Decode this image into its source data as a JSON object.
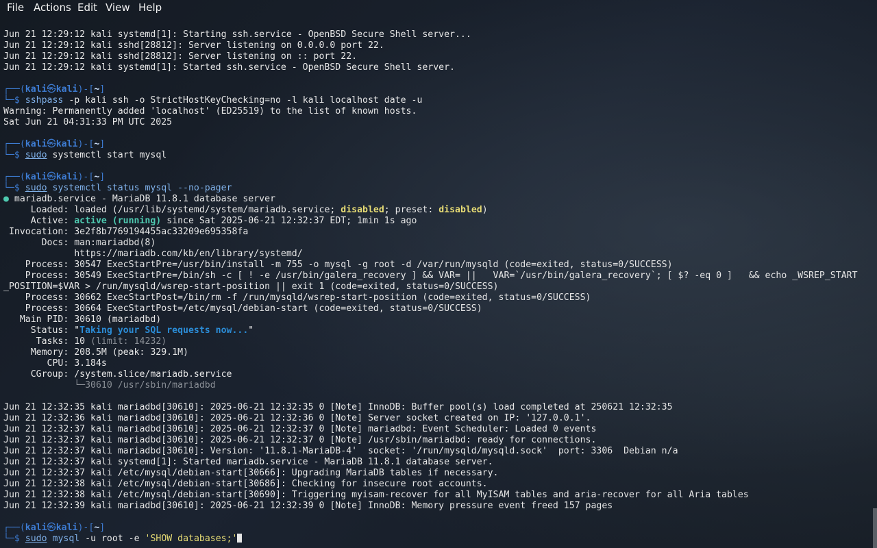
{
  "menubar": {
    "file": "File",
    "actions": "Actions",
    "edit": "Edit",
    "view": "View",
    "help": "Help"
  },
  "prompt": {
    "head": "┌──(",
    "user": "kali",
    "at": "㉿",
    "host": "kali",
    "dir_open": ")-[",
    "dir": "~",
    "dir_close": "]",
    "tail": "└─$"
  },
  "lines": {
    "l01": "Jun 21 12:29:12 kali systemd[1]: Starting ssh.service - OpenBSD Secure Shell server...",
    "l02": "Jun 21 12:29:12 kali sshd[28812]: Server listening on 0.0.0.0 port 22.",
    "l03": "Jun 21 12:29:12 kali sshd[28812]: Server listening on :: port 22.",
    "l04": "Jun 21 12:29:12 kali systemd[1]: Started ssh.service - OpenBSD Secure Shell server.",
    "cmd1_a": "sshpass",
    "cmd1_b": "-p kali ssh -o StrictHostKeyChecking=no -l kali localhost date -u",
    "l05": "Warning: Permanently added 'localhost' (ED25519) to the list of known hosts.",
    "l06": "Sat Jun 21 04:31:33 PM UTC 2025",
    "cmd2_sudo": "sudo",
    "cmd2_rest": "systemctl start mysql",
    "cmd3_sudo": "sudo",
    "cmd3_rest": "systemctl status mysql --no-pager",
    "svc_dot": "●",
    "svc_title": "mariadb.service - MariaDB 11.8.1 database server",
    "loaded_label": "     Loaded: ",
    "loaded_pre": "loaded (/usr/lib/systemd/system/mariadb.service; ",
    "loaded_disabled": "disabled",
    "loaded_mid": "; preset: ",
    "loaded_preset": "disabled",
    "loaded_end": ")",
    "active_label": "     Active: ",
    "active_state": "active (running)",
    "active_rest": " since Sat 2025-06-21 12:32:37 EDT; 1min 1s ago",
    "invocation": " Invocation: 3e2f8b7769194455ac33209e695358fa",
    "docs1": "       Docs: man:mariadbd(8)",
    "docs2": "             https://mariadb.com/kb/en/library/systemd/",
    "proc1": "    Process: 30547 ExecStartPre=/usr/bin/install -m 755 -o mysql -g root -d /var/run/mysqld (code=exited, status=0/SUCCESS)",
    "proc2a": "    Process: 30549 ExecStartPre=/bin/sh -c [ ! -e /usr/bin/galera_recovery ] && VAR= ||   VAR=`/usr/bin/galera_recovery`; [ $? -eq 0 ]   && echo _WSREP_START",
    "proc2b": "_POSITION=$VAR > /run/mysqld/wsrep-start-position || exit 1 (code=exited, status=0/SUCCESS)",
    "proc3": "    Process: 30662 ExecStartPost=/bin/rm -f /run/mysqld/wsrep-start-position (code=exited, status=0/SUCCESS)",
    "proc4": "    Process: 30664 ExecStartPost=/etc/mysql/debian-start (code=exited, status=0/SUCCESS)",
    "mainpid": "   Main PID: 30610 (mariadbd)",
    "status_label": "     Status: \"",
    "status_val": "Taking your SQL requests now...",
    "status_end": "\"",
    "tasks_label": "      Tasks: 10 ",
    "tasks_limit": "(limit: 14232)",
    "memory": "     Memory: 208.5M (peak: 329.1M)",
    "cpu": "        CPU: 3.184s",
    "cgroup": "     CGroup: /system.slice/mariadb.service",
    "cgroup_child": "             └─30610 /usr/sbin/mariadbd",
    "j01": "Jun 21 12:32:35 kali mariadbd[30610]: 2025-06-21 12:32:35 0 [Note] InnoDB: Buffer pool(s) load completed at 250621 12:32:35",
    "j02": "Jun 21 12:32:36 kali mariadbd[30610]: 2025-06-21 12:32:36 0 [Note] Server socket created on IP: '127.0.0.1'.",
    "j03": "Jun 21 12:32:37 kali mariadbd[30610]: 2025-06-21 12:32:37 0 [Note] mariadbd: Event Scheduler: Loaded 0 events",
    "j04": "Jun 21 12:32:37 kali mariadbd[30610]: 2025-06-21 12:32:37 0 [Note] /usr/sbin/mariadbd: ready for connections.",
    "j05": "Jun 21 12:32:37 kali mariadbd[30610]: Version: '11.8.1-MariaDB-4'  socket: '/run/mysqld/mysqld.sock'  port: 3306  Debian n/a",
    "j06": "Jun 21 12:32:37 kali systemd[1]: Started mariadb.service - MariaDB 11.8.1 database server.",
    "j07": "Jun 21 12:32:37 kali /etc/mysql/debian-start[30666]: Upgrading MariaDB tables if necessary.",
    "j08": "Jun 21 12:32:38 kali /etc/mysql/debian-start[30686]: Checking for insecure root accounts.",
    "j09": "Jun 21 12:32:38 kali /etc/mysql/debian-start[30690]: Triggering myisam-recover for all MyISAM tables and aria-recover for all Aria tables",
    "j10": "Jun 21 12:32:39 kali mariadbd[30610]: 2025-06-21 12:32:39 0 [Note] InnoDB: Memory pressure event freed 157 pages",
    "cmd4_sudo": "sudo",
    "cmd4_mysql": "mysql",
    "cmd4_rest": "-u root -e ",
    "cmd4_str": "'SHOW databases;'"
  }
}
